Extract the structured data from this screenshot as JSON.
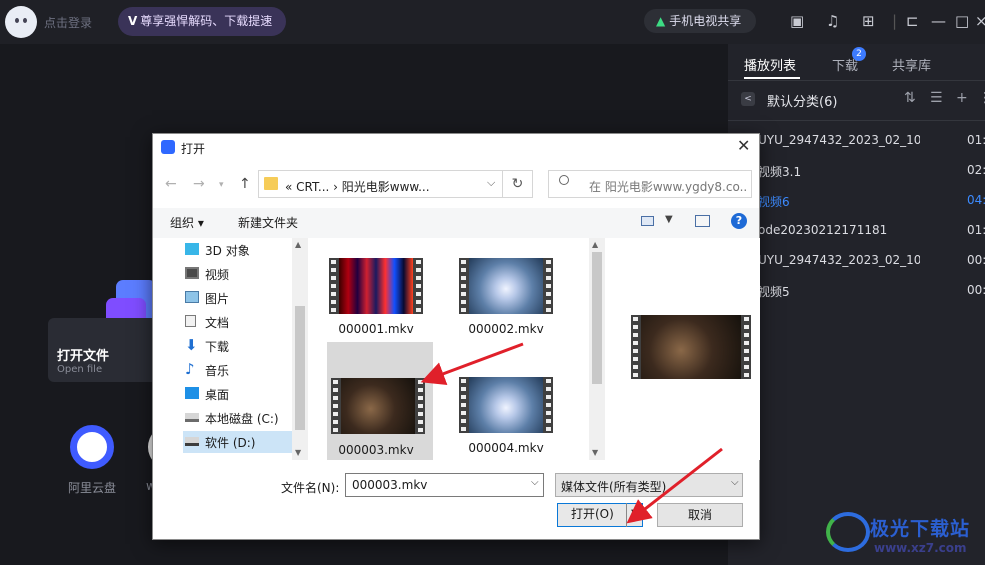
{
  "topbar": {
    "login": "点击登录",
    "vip_mark": "V",
    "vip_text": "尊享强悍解码、下载提速",
    "tv_share": "手机电视共享"
  },
  "home": {
    "open_file_title": "打开文件",
    "open_file_sub": "Open file",
    "aliyun": "阿里云盘",
    "w_label": "w"
  },
  "right_panel": {
    "tabs": [
      "播放列表",
      "下载",
      "共享库"
    ],
    "download_badge": "2",
    "category": "默认分类(6)",
    "items": [
      {
        "name": "UYU_2947432_2023_02_10...",
        "time": "01:"
      },
      {
        "name": "视频3.1",
        "time": "02:"
      },
      {
        "name": "视频6",
        "time": "04:",
        "active": true
      },
      {
        "name": "ode20230212171181",
        "time": "01:"
      },
      {
        "name": "UYU_2947432_2023_02_10...",
        "time": "00:"
      },
      {
        "name": "视频5",
        "time": "00:"
      }
    ]
  },
  "dialog": {
    "title": "打开",
    "address": "« CRT... › 阳光电影www...",
    "search_placeholder": "在 阳光电影www.ygdy8.co...",
    "organize": "组织 ▾",
    "new_folder": "新建文件夹",
    "help": "?",
    "nav": [
      {
        "label": "3D 对象",
        "icon": "cube-icon"
      },
      {
        "label": "视频",
        "icon": "film-icon"
      },
      {
        "label": "图片",
        "icon": "picture-icon"
      },
      {
        "label": "文档",
        "icon": "document-icon"
      },
      {
        "label": "下载",
        "icon": "download-icon"
      },
      {
        "label": "音乐",
        "icon": "music-icon"
      },
      {
        "label": "桌面",
        "icon": "desktop-icon"
      },
      {
        "label": "本地磁盘 (C:)",
        "icon": "drive-icon"
      },
      {
        "label": "软件 (D:)",
        "icon": "drive-icon",
        "selected": true
      }
    ],
    "files": [
      {
        "name": "000001.mkv"
      },
      {
        "name": "000002.mkv"
      },
      {
        "name": "000003.mkv",
        "selected": true
      },
      {
        "name": "000004.mkv"
      }
    ],
    "filename_label": "文件名(N):",
    "filename_value": "000003.mkv",
    "filetype": "媒体文件(所有类型)",
    "open_button": "打开(O)",
    "cancel_button": "取消"
  },
  "watermark": {
    "brand": "极光下载站",
    "url": "www.xz7.com"
  },
  "colors": {
    "accent": "#3d8bff",
    "arrow": "#e0202a",
    "vip_bg": "#3a3358"
  }
}
